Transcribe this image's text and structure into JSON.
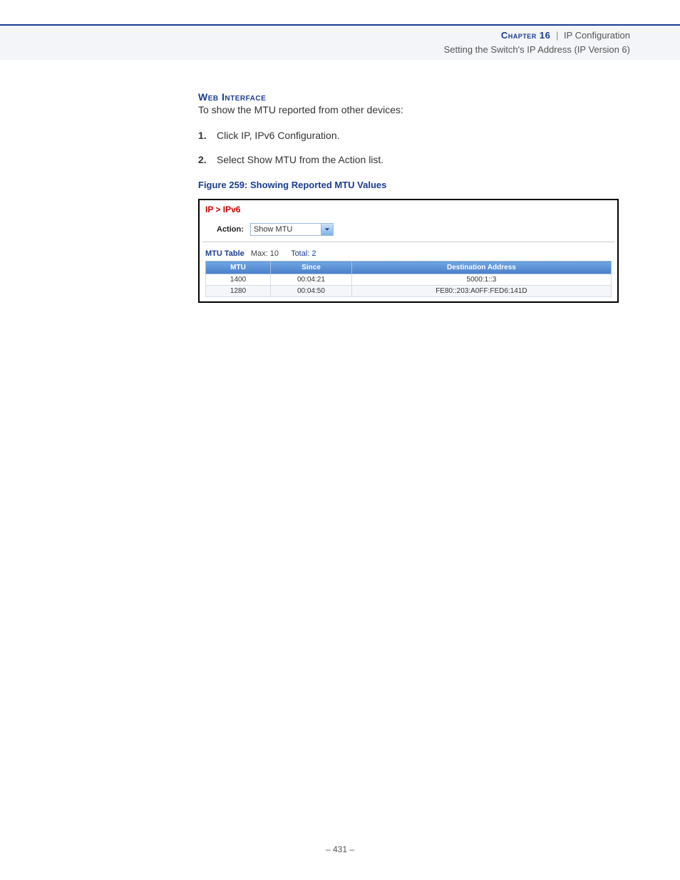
{
  "header": {
    "chapter": "Chapter 16",
    "separator": "|",
    "title": "IP Configuration",
    "subtitle": "Setting the Switch's IP Address (IP Version 6)"
  },
  "section_heading": "Web Interface",
  "intro_text": "To show the MTU reported from other devices:",
  "steps": [
    "Click IP, IPv6 Configuration.",
    "Select Show MTU from the Action list."
  ],
  "figure_caption": "Figure 259:  Showing Reported MTU Values",
  "ui": {
    "breadcrumb": "IP > IPv6",
    "action_label": "Action:",
    "action_value": "Show MTU",
    "table_label": "MTU Table",
    "max_label": "Max: 10",
    "total_label": "Total: 2",
    "columns": {
      "c0": "MTU",
      "c1": "Since",
      "c2": "Destination Address"
    },
    "rows": [
      {
        "mtu": "1400",
        "since": "00:04:21",
        "dest": "5000:1::3"
      },
      {
        "mtu": "1280",
        "since": "00:04:50",
        "dest": "FE80::203:A0FF:FED6:141D"
      }
    ]
  },
  "page_number": "–  431  –"
}
